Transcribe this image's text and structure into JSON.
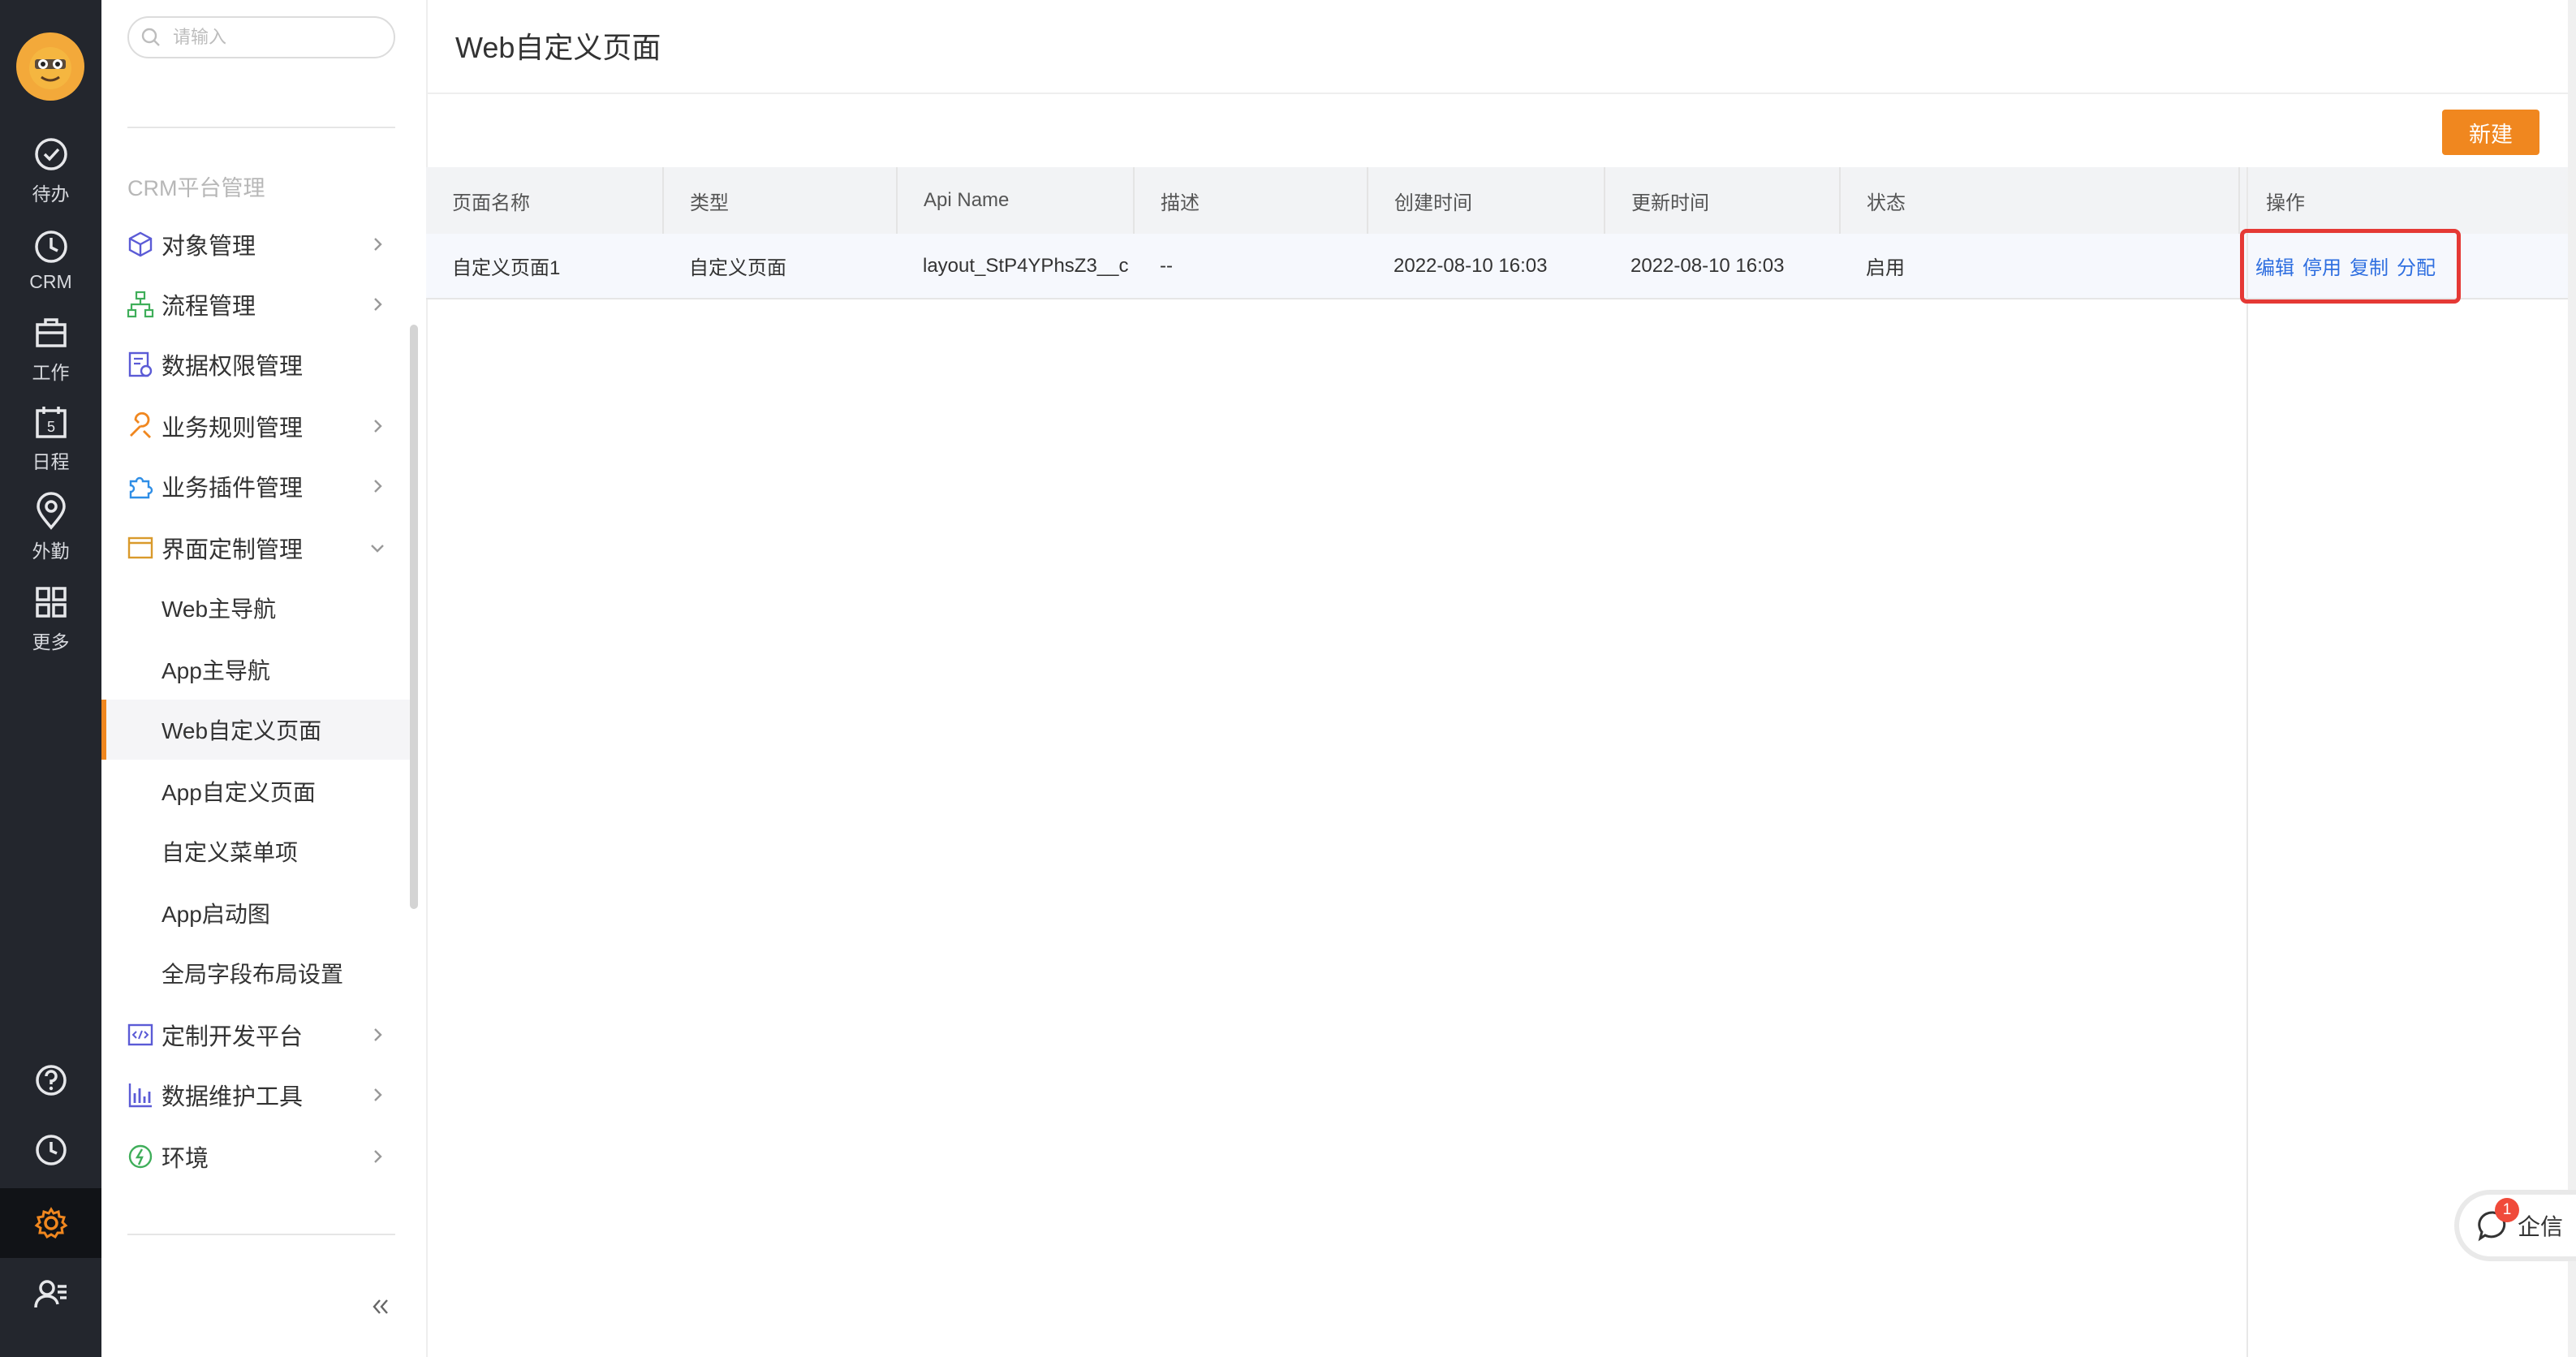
{
  "rail": {
    "items": [
      {
        "label": "待办",
        "icon": "check-circle-icon"
      },
      {
        "label": "CRM",
        "icon": "clock-icon"
      },
      {
        "label": "工作",
        "icon": "briefcase-icon"
      },
      {
        "label": "日程",
        "icon": "calendar-icon",
        "day": "5"
      },
      {
        "label": "外勤",
        "icon": "location-pin-icon"
      },
      {
        "label": "更多",
        "icon": "grid-icon"
      }
    ]
  },
  "sidebar": {
    "search_placeholder": "请输入",
    "section_title": "CRM平台管理",
    "items": [
      {
        "label": "对象管理"
      },
      {
        "label": "流程管理"
      },
      {
        "label": "数据权限管理"
      },
      {
        "label": "业务规则管理"
      },
      {
        "label": "业务插件管理"
      },
      {
        "label": "界面定制管理"
      },
      {
        "label": "定制开发平台"
      },
      {
        "label": "数据维护工具"
      },
      {
        "label": "环境"
      }
    ],
    "sub_items": [
      {
        "label": "Web主导航"
      },
      {
        "label": "App主导航"
      },
      {
        "label": "Web自定义页面"
      },
      {
        "label": "App自定义页面"
      },
      {
        "label": "自定义菜单项"
      },
      {
        "label": "App启动图"
      },
      {
        "label": "全局字段布局设置"
      }
    ]
  },
  "main": {
    "title": "Web自定义页面",
    "new_button": "新建",
    "columns": [
      "页面名称",
      "类型",
      "Api Name",
      "描述",
      "创建时间",
      "更新时间",
      "状态",
      "操作"
    ],
    "rows": [
      {
        "name": "自定义页面1",
        "type": "自定义页面",
        "api_name": "layout_StP4YPhsZ3__c",
        "desc": "--",
        "created": "2022-08-10 16:03",
        "updated": "2022-08-10 16:03",
        "status": "启用",
        "actions": [
          "编辑",
          "停用",
          "复制",
          "分配"
        ]
      }
    ]
  },
  "qixin": {
    "label": "企信",
    "badge": "1"
  },
  "colors": {
    "accent": "#f0871f",
    "link": "#2f6fe0",
    "highlight": "#e53935",
    "rail": "#23262d"
  }
}
